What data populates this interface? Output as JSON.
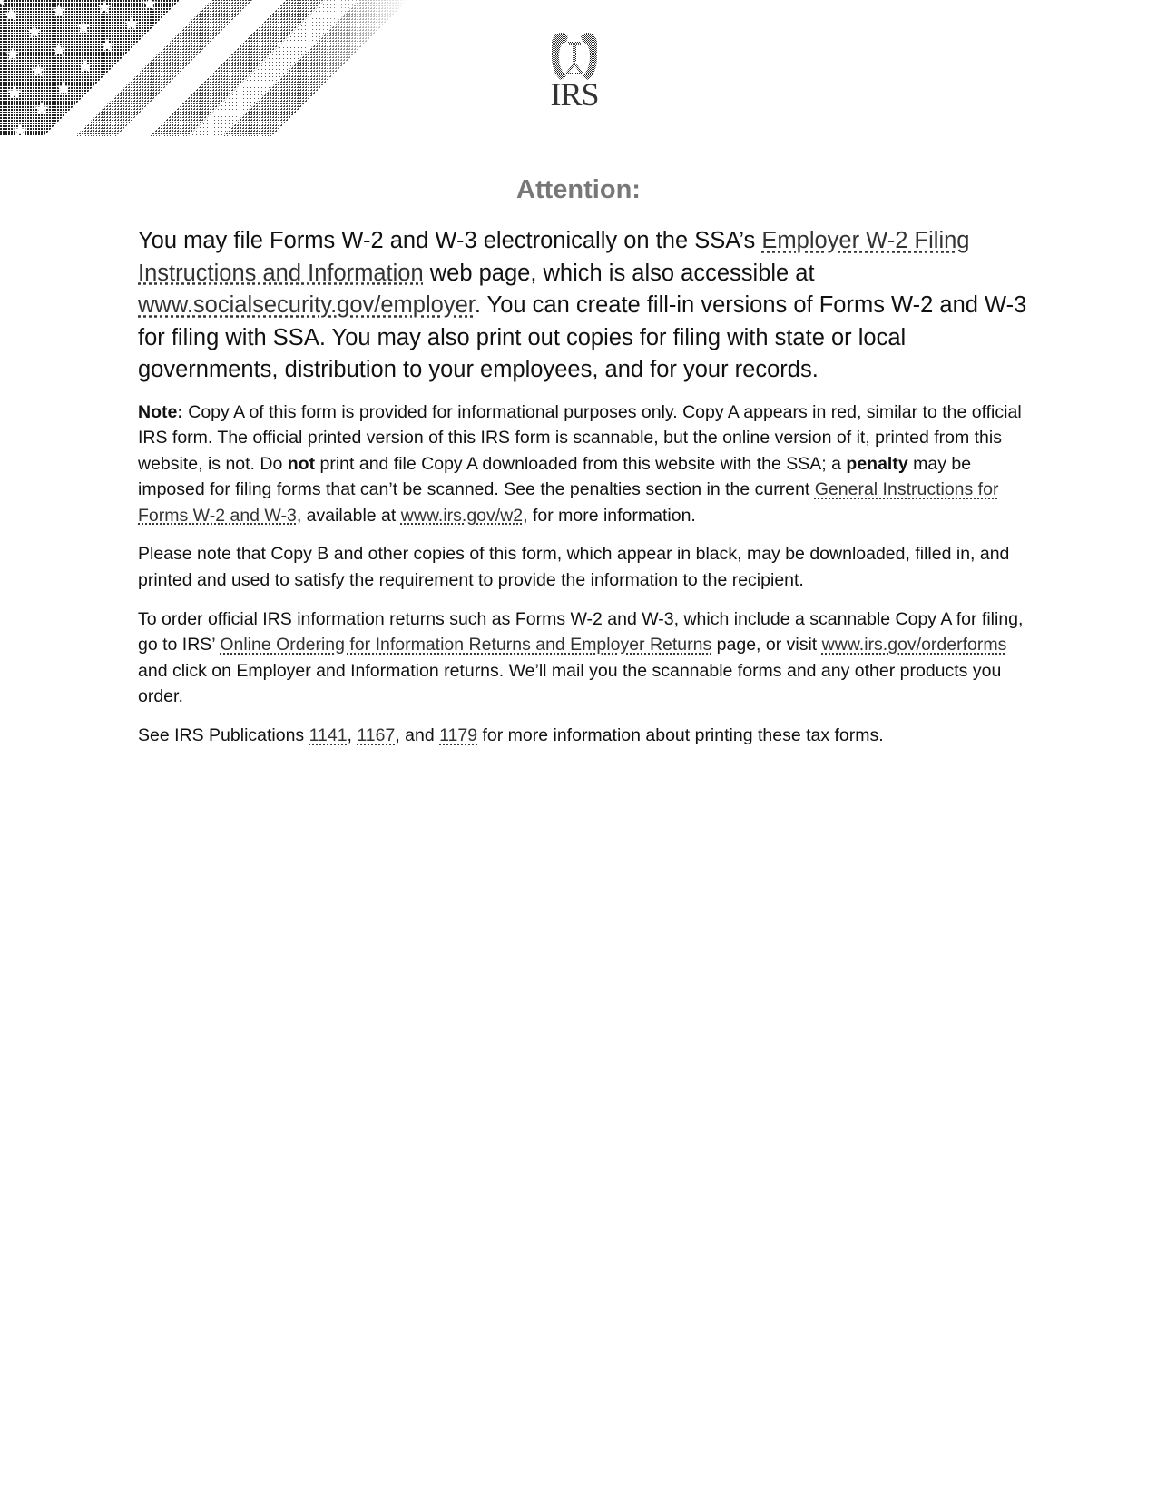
{
  "header": {
    "banner": "american-flag-banner",
    "logo_text": "IRS"
  },
  "title": "Attention:",
  "lead": {
    "t1": "You may file Forms W-2 and W-3 electronically on the SSA’s ",
    "link1": "Employer W-2 Filing Instructions and Information",
    "t2": " web page, which is also accessible at ",
    "link2": "www.socialsecurity.gov/employer",
    "t3": ".  You can create fill-in versions of Forms W-2 and W-3 for filing with SSA. You may also print out copies for filing with state or local governments, distribution to your employees, and for your records."
  },
  "note": {
    "label": "Note:",
    "t1": " Copy A of this form is provided for informational purposes only. Copy A appears in red, similar to the official IRS form. The official printed version of this IRS form is scannable, but the online version of it, printed from this website, is not. Do ",
    "bold1": "not",
    "t2": " print and file Copy A downloaded from this website with the SSA; a ",
    "bold2": "penalty",
    "t3": " may be imposed for filing forms that can’t be scanned. See the penalties section in the current ",
    "link1": "General Instructions for Forms W-2 and W-3",
    "t4": ", available at ",
    "link2": "www.irs.gov/w2",
    "t5": ", for more information."
  },
  "para2": "Please note that Copy B and other copies of this form, which appear in black, may be downloaded, filled in, and printed and used to satisfy the requirement to provide the information to the recipient.",
  "para3": {
    "t1": "To order official IRS information returns such as Forms W-2 and W-3, which include a scannable Copy A for filing, go to IRS’ ",
    "link1": "Online Ordering for Information Returns and Employer Returns",
    "t2": " page, or visit ",
    "link2": "www.irs.gov/orderforms",
    "t3": " and click on Employer and Information returns. We’ll mail you the scannable forms and any other products you order."
  },
  "para4": {
    "t1": "See IRS Publications ",
    "pub1": "1141",
    "sep1": ", ",
    "pub2": "1167",
    "sep2": ", and ",
    "pub3": "1179",
    "t2": " for more information about printing these tax forms."
  }
}
